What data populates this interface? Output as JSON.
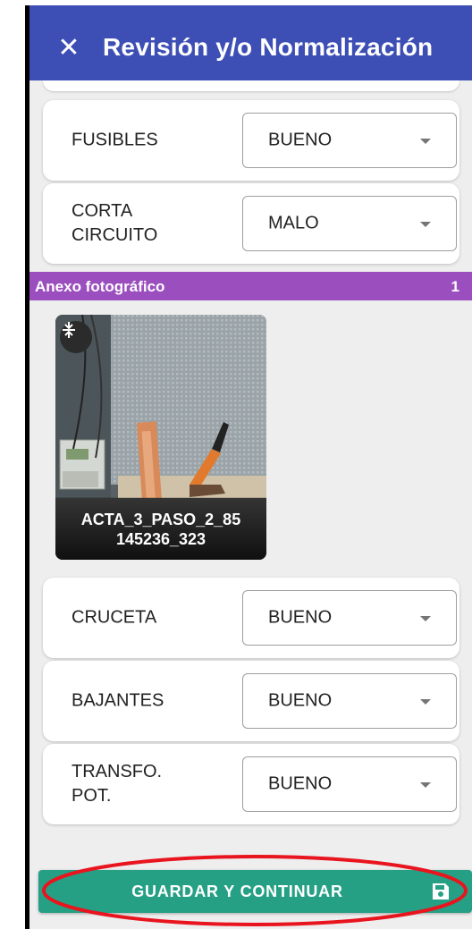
{
  "header": {
    "title": "Revisión y/o Normalización",
    "close_icon": "close-icon"
  },
  "rows_top": [
    {
      "label": "FUSIBLES",
      "value": "BUENO"
    },
    {
      "label": "CORTA\nCIRCUITO",
      "value": "MALO"
    }
  ],
  "anexo": {
    "title": "Anexo fotográfico",
    "count": "1",
    "photo_caption": "ACTA_3_PASO_2_85\n145236_323",
    "compress_icon": "compress-icon"
  },
  "rows_bottom": [
    {
      "label": "CRUCETA",
      "value": "BUENO"
    },
    {
      "label": "BAJANTES",
      "value": "BUENO"
    },
    {
      "label": "TRANSFO.\nPOT.",
      "value": "BUENO"
    }
  ],
  "footer": {
    "save_label": "GUARDAR Y CONTINUAR",
    "save_icon": "floppy-disk-icon"
  },
  "colors": {
    "appbar": "#3d4fb5",
    "anexo_bar": "#9b4fbf",
    "save_button": "#26a085",
    "annotation": "#e8141e"
  }
}
